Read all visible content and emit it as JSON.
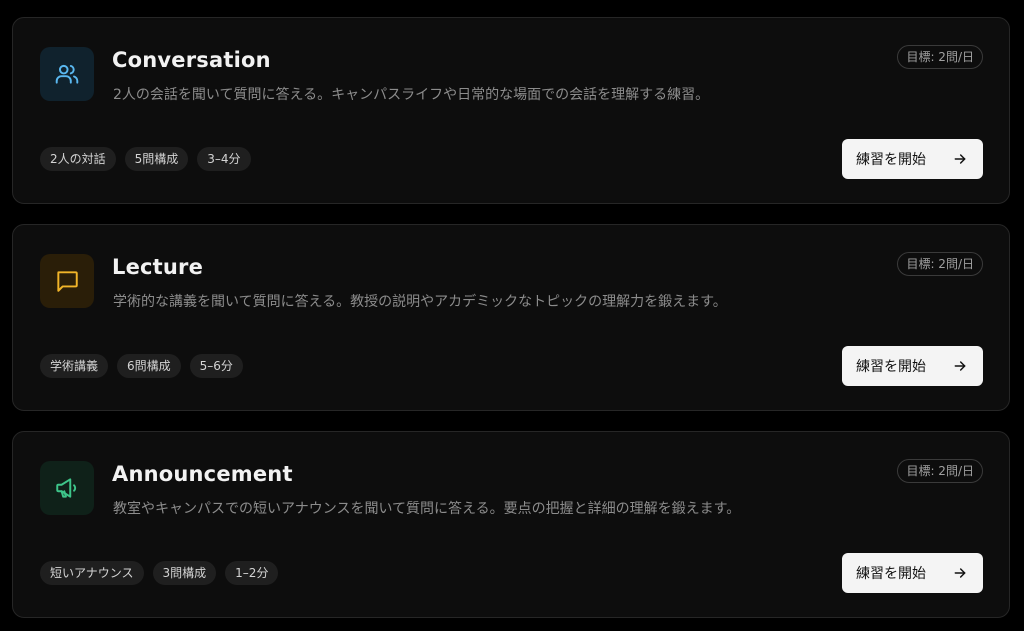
{
  "cards": [
    {
      "title": "Conversation",
      "description": "2人の会話を聞いて質問に答える。キャンパスライフや日常的な場面での会話を理解する練習。",
      "goal": "目標: 2問/日",
      "tags": [
        "2人の対話",
        "5問構成",
        "3–4分"
      ],
      "button_label": "練習を開始",
      "icon": "users-icon",
      "accent": "#5ab8f0",
      "icon_bg": "#10222d"
    },
    {
      "title": "Lecture",
      "description": "学術的な講義を聞いて質問に答える。教授の説明やアカデミックなトピックの理解力を鍛えます。",
      "goal": "目標: 2問/日",
      "tags": [
        "学術講義",
        "6問構成",
        "5–6分"
      ],
      "button_label": "練習を開始",
      "icon": "message-square-icon",
      "accent": "#f0b429",
      "icon_bg": "#2a1e08"
    },
    {
      "title": "Announcement",
      "description": "教室やキャンパスでの短いアナウンスを聞いて質問に答える。要点の把握と詳細の理解を鍛えます。",
      "goal": "目標: 2問/日",
      "tags": [
        "短いアナウンス",
        "3問構成",
        "1–2分"
      ],
      "button_label": "練習を開始",
      "icon": "megaphone-icon",
      "accent": "#3ec58a",
      "icon_bg": "#0f2119"
    }
  ]
}
